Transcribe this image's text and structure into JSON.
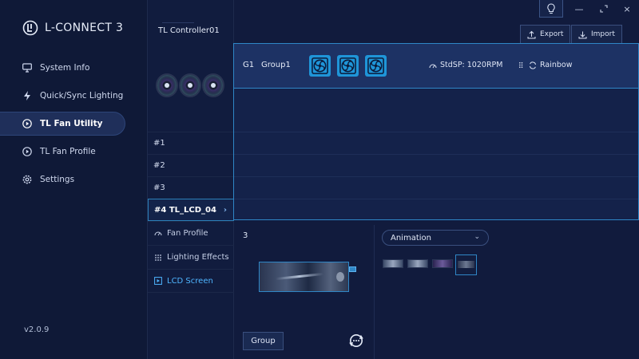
{
  "app": {
    "brand": "L-CONNECT 3",
    "version": "v2.0.9"
  },
  "sidebar": {
    "items": [
      {
        "label": "System Info",
        "icon": "monitor-icon"
      },
      {
        "label": "Quick/Sync Lighting",
        "icon": "lightning-icon"
      },
      {
        "label": "TL Fan Utility",
        "icon": "play-circle-icon",
        "active": true
      },
      {
        "label": "TL Fan Profile",
        "icon": "play-circle-icon"
      },
      {
        "label": "Settings",
        "icon": "gear-icon"
      }
    ]
  },
  "controller": {
    "title": "TL Controller01",
    "rows": [
      "#1",
      "#2",
      "#3"
    ],
    "selected_row": "#4 TL_LCD_04",
    "sub_items": [
      {
        "label": "Fan Profile",
        "icon": "fan-profile-icon"
      },
      {
        "label": "Lighting Effects",
        "icon": "lighting-dots-icon"
      },
      {
        "label": "LCD Screen",
        "icon": "lcd-screen-icon",
        "active": true
      }
    ]
  },
  "toolbar": {
    "export_label": "Export",
    "import_label": "Import"
  },
  "group": {
    "id": "G1",
    "name": "Group1",
    "speed": "StdSP: 1020RPM",
    "effect": "Rainbow",
    "fan_count": 3
  },
  "lcd": {
    "number": "3",
    "group_button": "Group",
    "animation_select": "Animation",
    "thumbnails": 4,
    "selected_thumbnail": 4
  },
  "colors": {
    "accent": "#2f86c6",
    "fan_icon": "#1f95d8",
    "active_nav": "#1f2f5a",
    "lcd_active": "#4fb5ff"
  }
}
